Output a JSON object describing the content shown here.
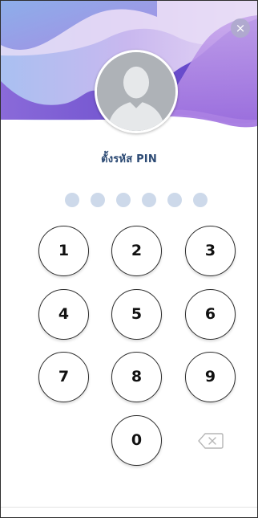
{
  "header": {
    "close_label": "×"
  },
  "title": "ตั้งรหัส PIN",
  "pin": {
    "length": 6,
    "entered": 0,
    "dot_color": "#cdd9ea"
  },
  "keypad": {
    "keys": [
      "1",
      "2",
      "3",
      "4",
      "5",
      "6",
      "7",
      "8",
      "9",
      "0"
    ],
    "backspace_icon": "backspace-icon"
  },
  "colors": {
    "title": "#2c4a74",
    "wave_light": "#d9cbf0",
    "wave_mid": "#b497e6",
    "wave_dark": "#6a4fd0",
    "wave_blue": "#7fa7e8"
  }
}
